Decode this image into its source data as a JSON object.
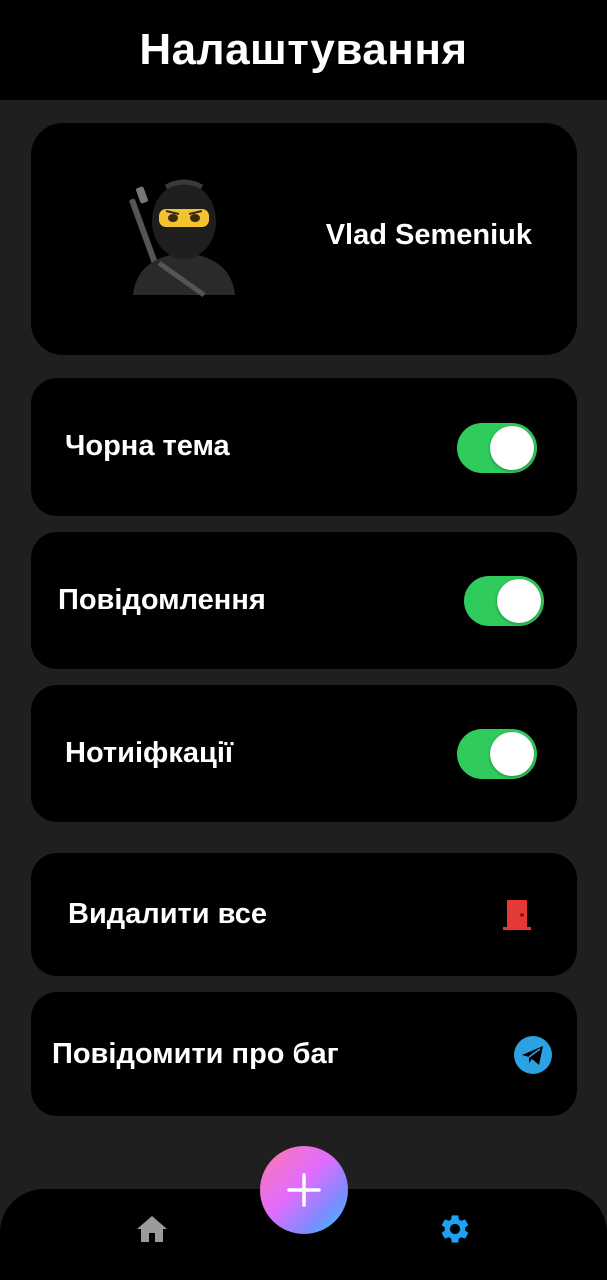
{
  "header": {
    "title": "Налаштування"
  },
  "profile": {
    "name": "Vlad Semeniuk",
    "avatar_icon": "ninja-avatar"
  },
  "settings": [
    {
      "label": "Чорна тема",
      "enabled": true
    },
    {
      "label": "Повідомлення",
      "enabled": true
    },
    {
      "label": "Нотиіфкації",
      "enabled": true
    }
  ],
  "actions": [
    {
      "label": "Видалити все",
      "icon": "door-icon"
    },
    {
      "label": "Повідомити про баг",
      "icon": "telegram-icon"
    }
  ],
  "fab": {
    "icon": "plus-icon"
  },
  "nav": [
    {
      "icon": "home-icon",
      "active": false
    },
    {
      "icon": "gear-icon",
      "active": true
    }
  ],
  "colors": {
    "background": "#1f1f1f",
    "card": "#000000",
    "toggle_on": "#2fcc5d",
    "active_nav": "#1da1f2",
    "inactive_nav": "#9a9a9a",
    "danger": "#e53935"
  }
}
